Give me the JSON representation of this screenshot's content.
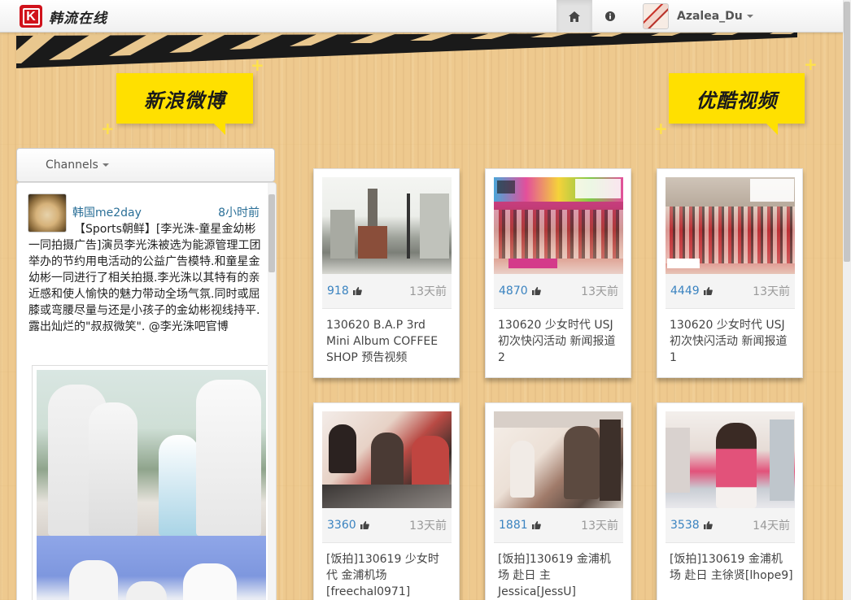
{
  "header": {
    "logo_letter": "K",
    "brand_text": "韩流在线",
    "home_icon": "home-icon",
    "info_icon": "info-icon",
    "user_name": "Azalea_Du"
  },
  "sections": {
    "weibo_label": "新浪微博",
    "youku_label": "优酷视频"
  },
  "weibo": {
    "channels_label": "Channels",
    "post": {
      "author": "韩国me2day",
      "time": "8小时前",
      "text": "【Sports朝鲜】[李光洙-童星金幼彬一同拍摄广告]演员李光洙被选为能源管理工团举办的节约用电活动的公益广告模特.和童星金幼彬一同进行了相关拍摄.李光洙以其特有的亲近感和使人愉快的魅力带动全场气氛.同时或屈膝或弯腰尽量与还是小孩子的金幼彬视线持平.露出灿烂的\"叔叔微笑\". @李光洙吧官博"
    }
  },
  "videos": [
    {
      "likes": "918",
      "ago": "13天前",
      "title": "130620 B.A.P 3rd Mini Album COFFEE SHOP 预告视频"
    },
    {
      "likes": "4870",
      "ago": "13天前",
      "title": "130620 少女时代 USJ 初次快闪活动 新闻报道 2"
    },
    {
      "likes": "4449",
      "ago": "13天前",
      "title": "130620 少女时代 USJ 初次快闪活动 新闻报道 1"
    },
    {
      "likes": "3360",
      "ago": "13天前",
      "title": "[饭拍]130619 少女时代 金浦机场 [freechal0971]"
    },
    {
      "likes": "1881",
      "ago": "13天前",
      "title": "[饭拍]130619 金浦机场 赴日 主Jessica[JessU]"
    },
    {
      "likes": "3538",
      "ago": "14天前",
      "title": "[饭拍]130619 金浦机场 赴日 主徐贤[lhope9]"
    }
  ],
  "colors": {
    "accent_yellow": "#ffe000",
    "brand_red": "#d0121b",
    "link_blue": "#3a83c0"
  }
}
